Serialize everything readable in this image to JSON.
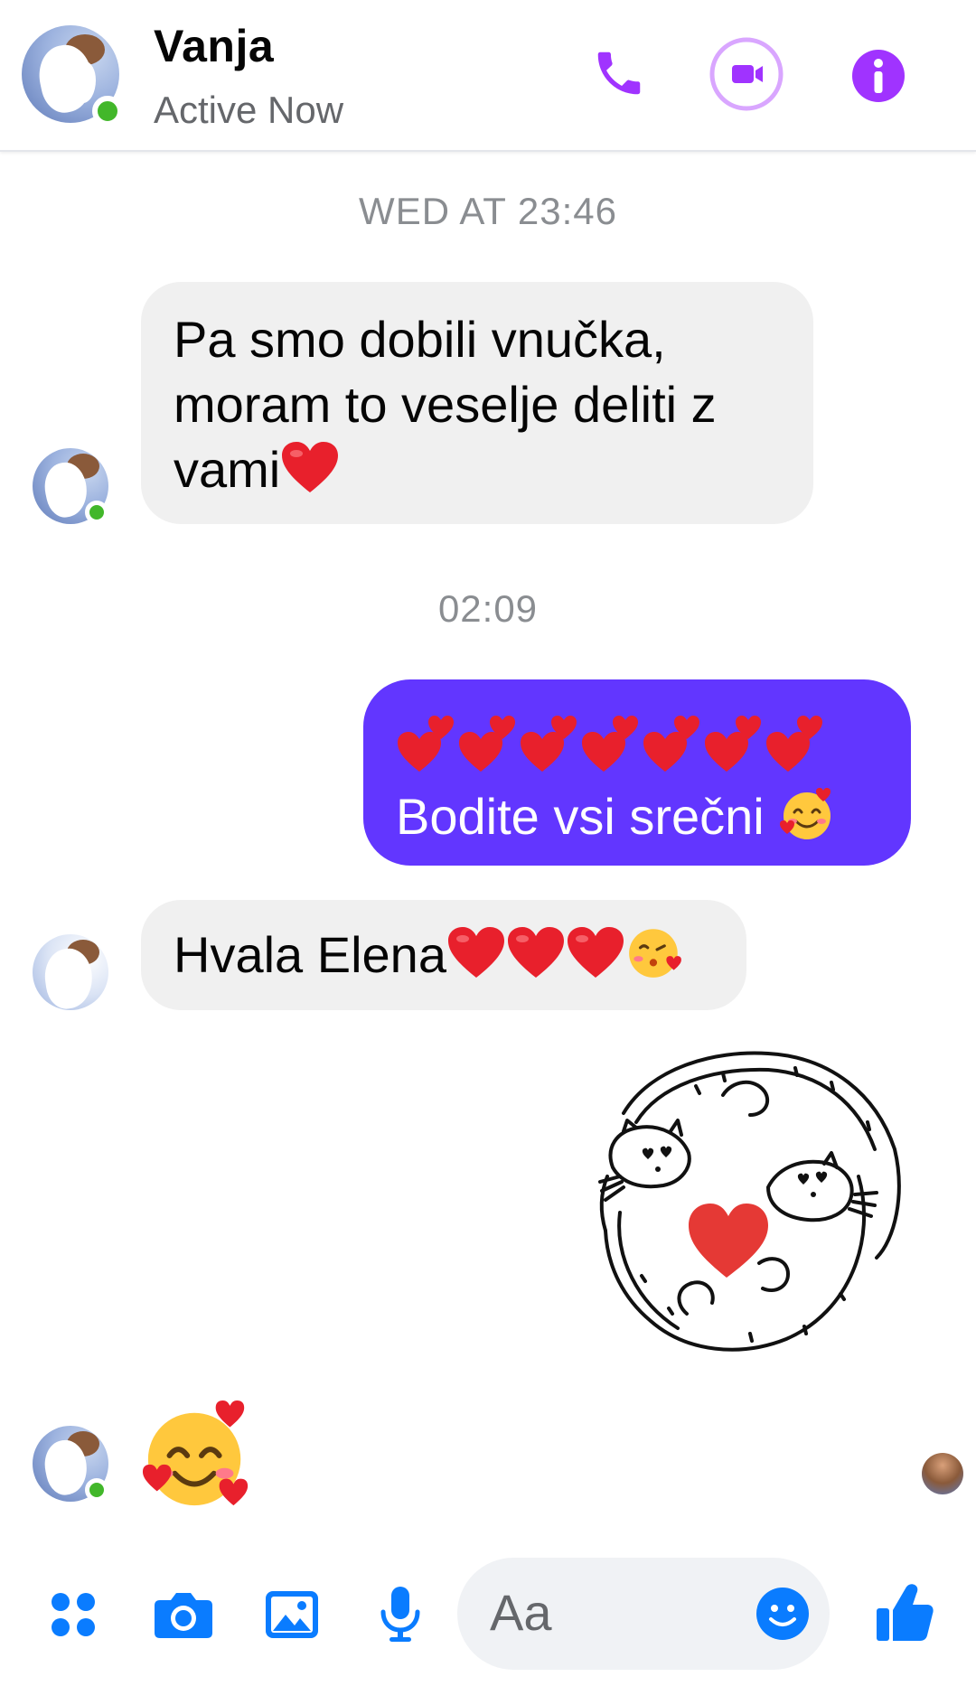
{
  "header": {
    "contact_name": "Vanja",
    "status": "Active Now",
    "icons": [
      "phone-icon",
      "video-camera-icon",
      "info-icon"
    ],
    "accent_color": "#a033ff"
  },
  "messages": [
    {
      "type": "timestamp",
      "text": "WED AT 23:46"
    },
    {
      "type": "incoming",
      "text": "Pa smo dobili vnučka, moram to veselje deliti z vami",
      "line1": "Pa smo dobili vnučka,",
      "line2": "moram to veselje deliti z",
      "line3": "vami",
      "trailing_emoji": "red-heart"
    },
    {
      "type": "timestamp",
      "text": "02:09"
    },
    {
      "type": "outgoing",
      "emoji_row": [
        "two-hearts",
        "two-hearts",
        "two-hearts",
        "two-hearts",
        "two-hearts",
        "two-hearts",
        "two-hearts"
      ],
      "text": "Bodite vsi srečni",
      "trailing_emoji": "smiling-face-with-hearts"
    },
    {
      "type": "incoming",
      "text": "Hvala Elena",
      "trailing_emoji": [
        "red-heart",
        "red-heart",
        "red-heart",
        "face-blowing-kiss"
      ]
    },
    {
      "type": "outgoing-sticker",
      "sticker": "two-otters-with-heart"
    },
    {
      "type": "incoming-emoji",
      "emoji": "smiling-face-with-hearts"
    }
  ],
  "composer": {
    "placeholder": "Aa",
    "icons": [
      "apps-icon",
      "camera-icon",
      "gallery-icon",
      "microphone-icon",
      "emoji-icon",
      "thumbs-up-icon"
    ],
    "icon_color": "#0a7cff"
  },
  "colors": {
    "outgoing_bubble": "#6236ff",
    "incoming_bubble": "#f0f0f0",
    "online": "#42b72a"
  }
}
